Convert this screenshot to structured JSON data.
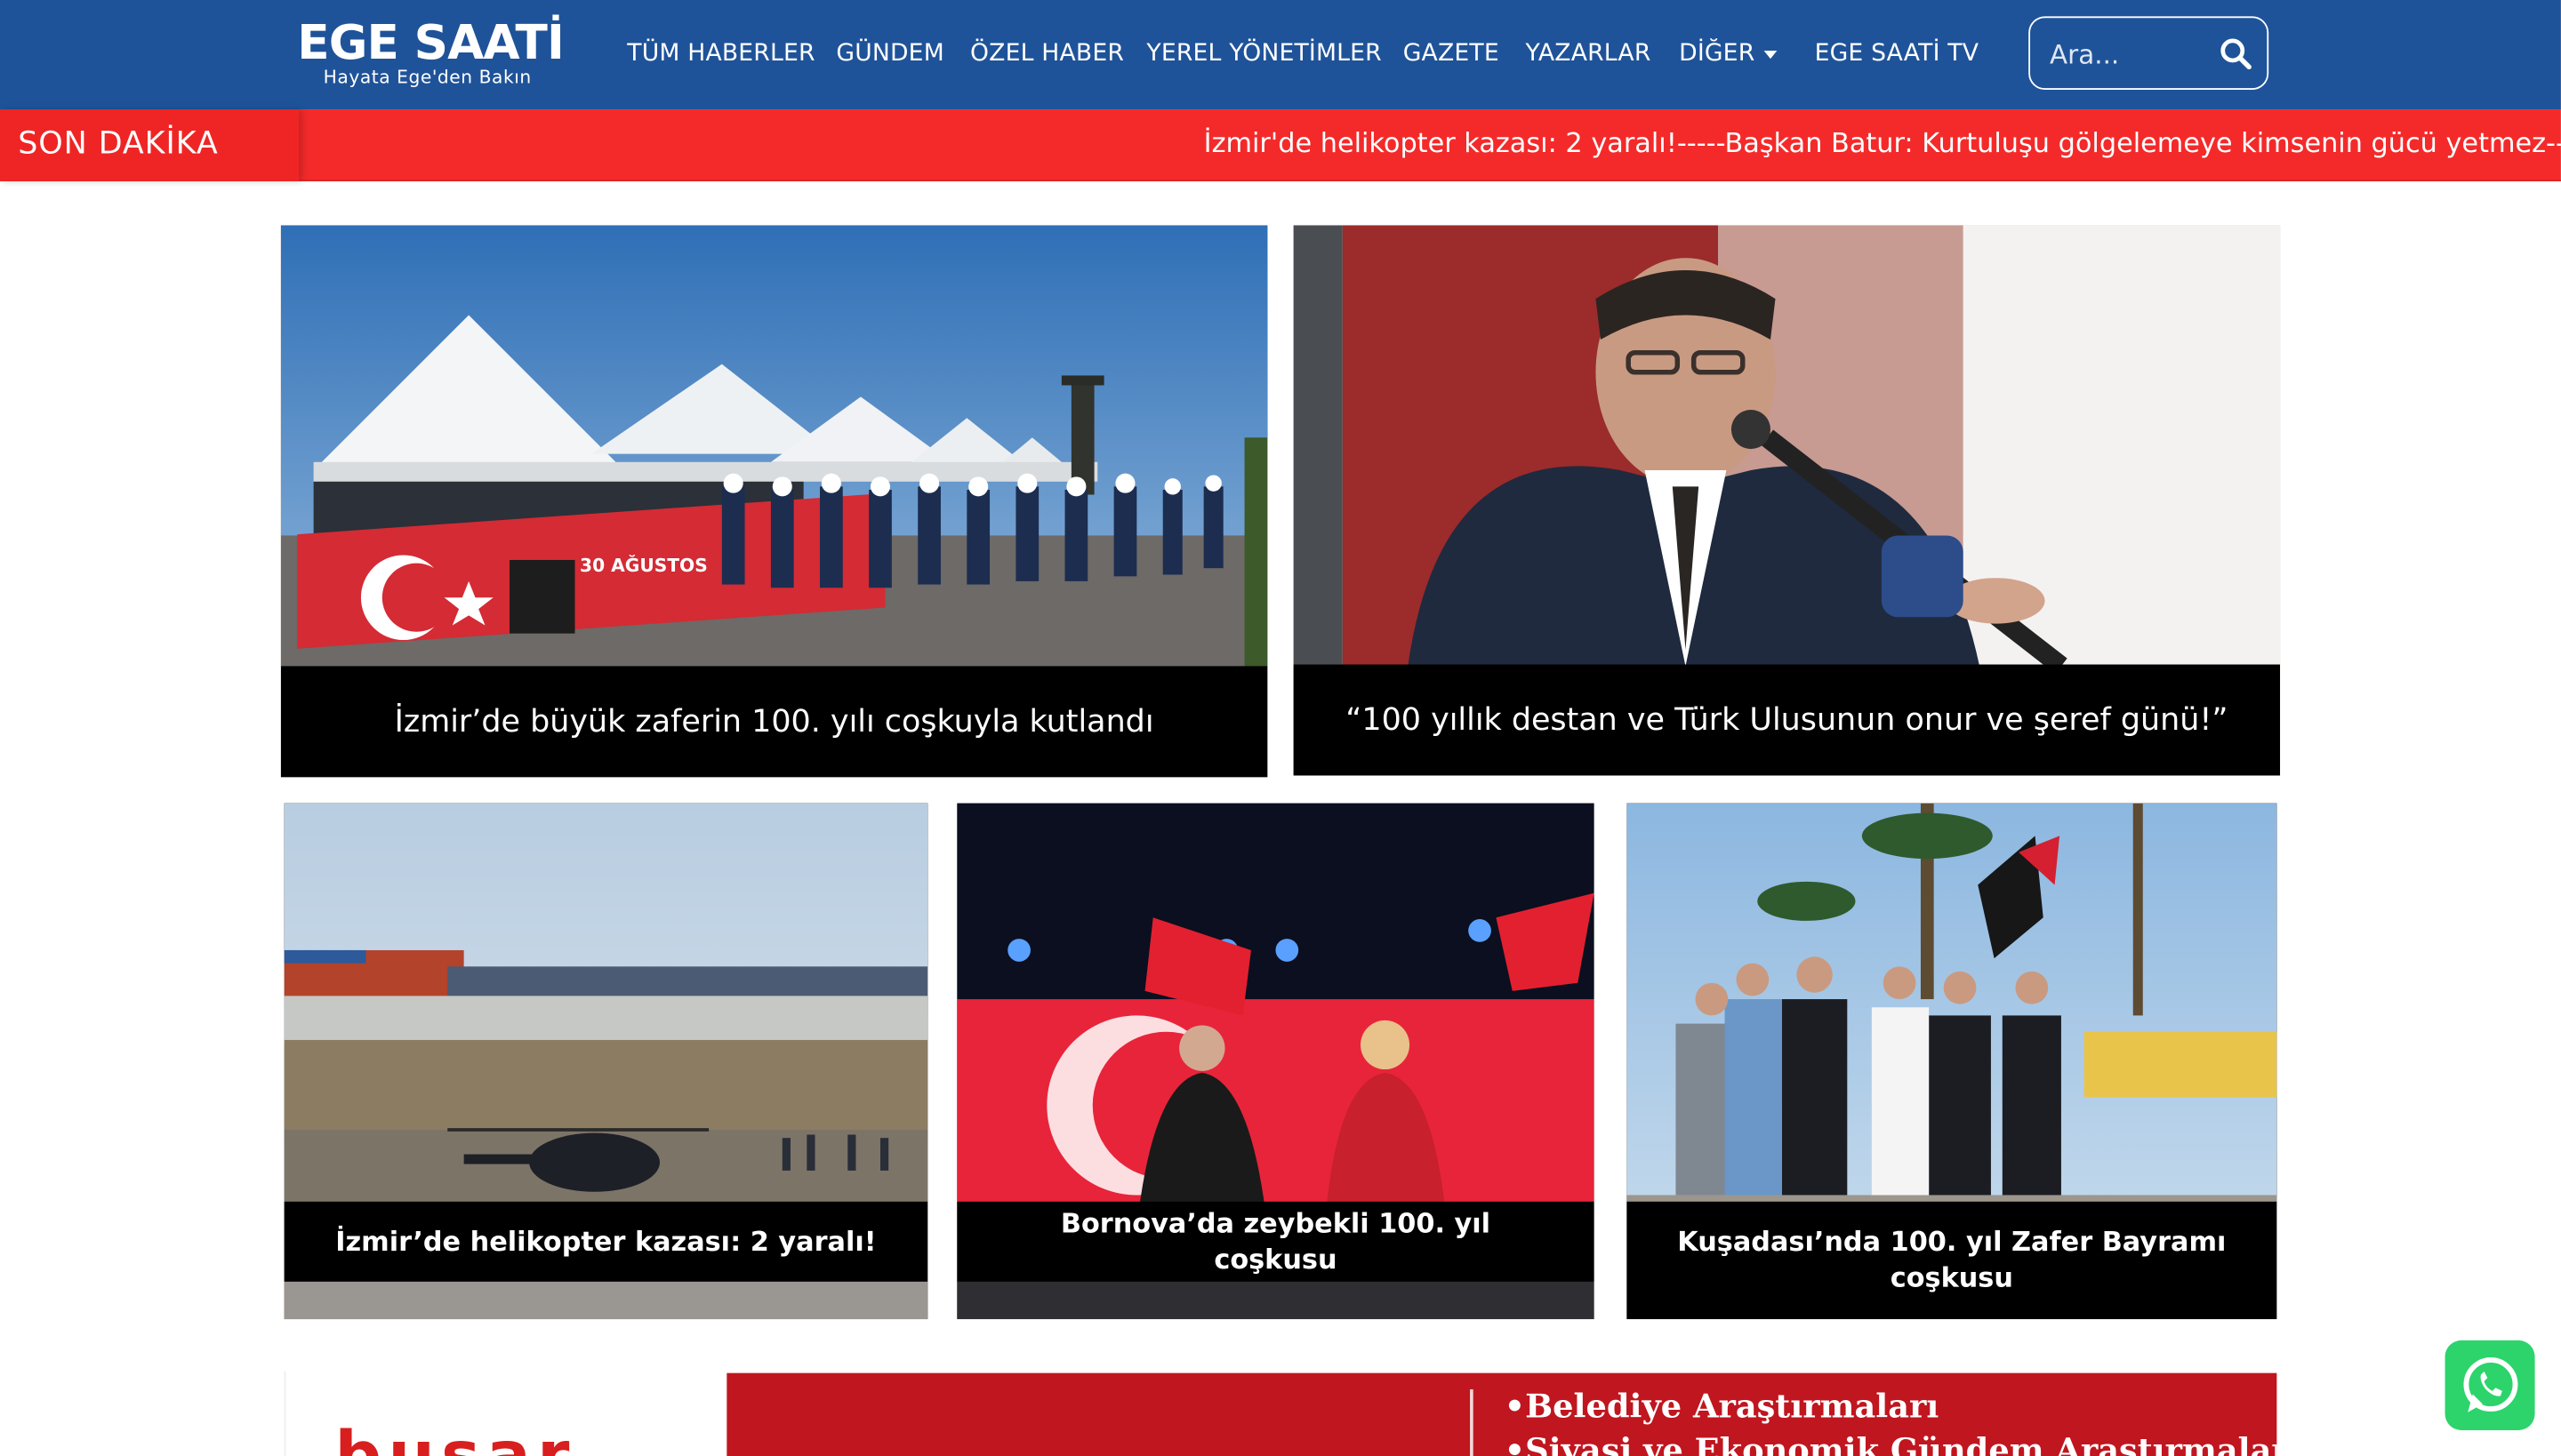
{
  "header": {
    "logo_title": "EGE SAATİ",
    "logo_subtitle": "Hayata Ege'den Bakın",
    "nav": [
      {
        "label": "TÜM HABERLER"
      },
      {
        "label": "GÜNDEM"
      },
      {
        "label": "ÖZEL HABER"
      },
      {
        "label": "YEREL YÖNETİMLER"
      },
      {
        "label": "GAZETE"
      },
      {
        "label": "YAZARLAR"
      },
      {
        "label": "DİĞER"
      },
      {
        "label": "EGE SAATİ TV"
      }
    ],
    "search_placeholder": "Ara...",
    "search_icon": "search-icon"
  },
  "breaking": {
    "label": "SON DAKİKA",
    "text": "İzmir'de helikopter kazası: 2 yaralı!-----Başkan Batur: Kurtuluşu gölgelemeye kimsenin gücü yetmez-----“"
  },
  "featured": [
    {
      "title": "İzmir’de büyük zaferin 100. yılı coşkuyla kutlandı",
      "image": "ceremony-parade-photo"
    },
    {
      "title": "“100 yıllık destan ve Türk Ulusunun onur ve şeref günü!”",
      "image": "speaker-podium-photo"
    }
  ],
  "news": [
    {
      "title": "İzmir’de helikopter kazası: 2 yaralı!",
      "image": "helicopter-crash-photo"
    },
    {
      "title": "Bornova’da zeybekli 100. yıl coşkusu",
      "image": "stage-flags-photo"
    },
    {
      "title": "Kuşadası’nda 100. yıl Zafer Bayramı coşkusu",
      "image": "officials-march-photo"
    }
  ],
  "banner": {
    "left_logo": "busar",
    "line1": "•Belediye Araştırmaları",
    "line2": "•Siyasi ve Ekonomik Gündem Araştırmaları"
  },
  "floating": {
    "icon": "whatsapp-icon"
  },
  "colors": {
    "header": "#1f5399",
    "breaking": "#f42a2a",
    "caption": "#000000",
    "banner": "#c0161f",
    "whatsapp": "#2cd46b"
  }
}
